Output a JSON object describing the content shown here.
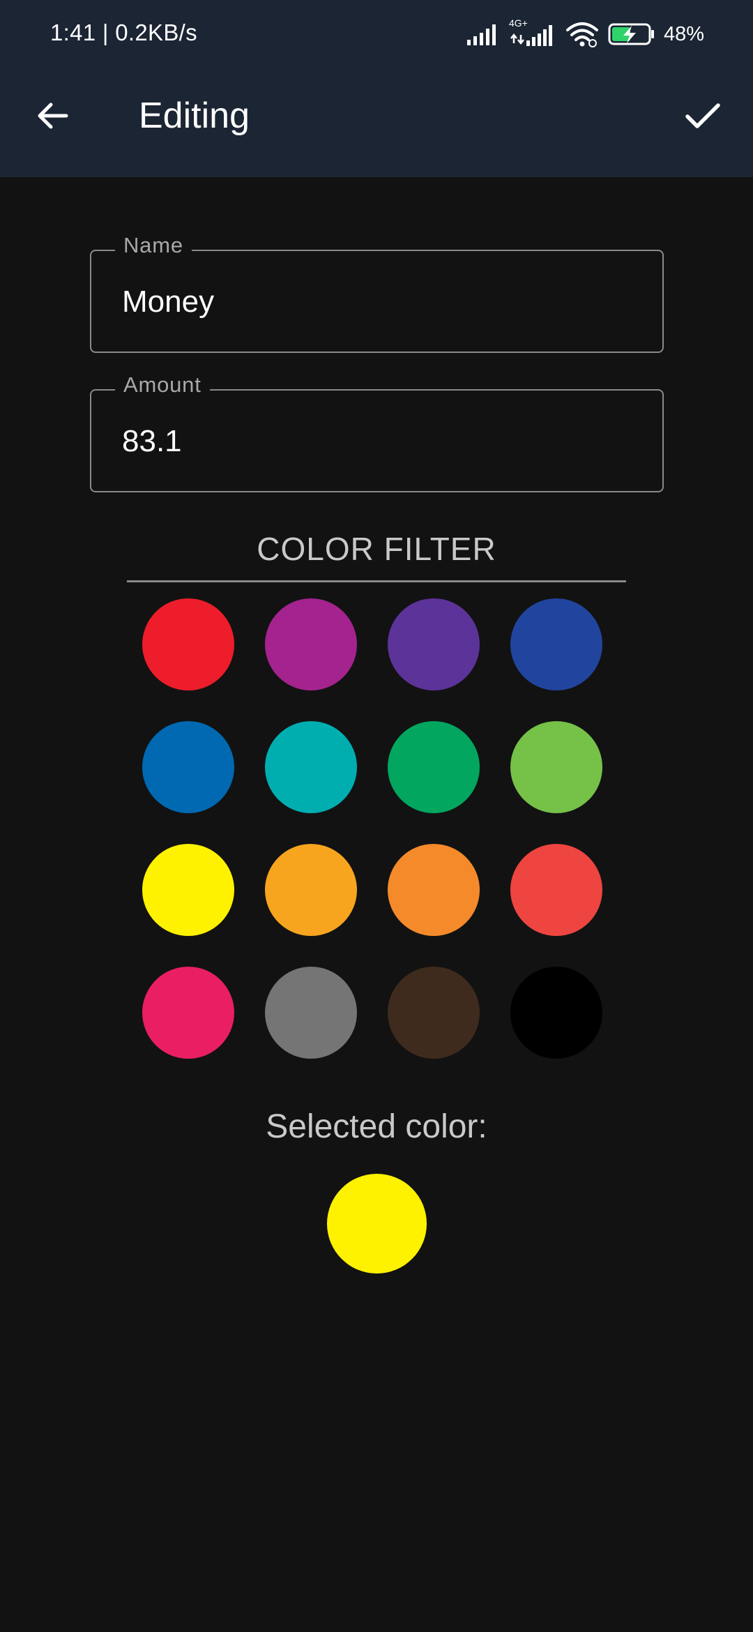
{
  "status_bar": {
    "time": "1:41 | 0.2KB/s",
    "network_type": "4G+",
    "battery": "48%",
    "icons": [
      "signal-icon",
      "signal-4g-icon",
      "wifi-icon",
      "battery-charging-icon"
    ]
  },
  "app_bar": {
    "title": "Editing",
    "back_icon": "arrow-back-icon",
    "confirm_icon": "check-icon",
    "background": "#1b2533"
  },
  "form": {
    "name_label": "Name",
    "name_value": "Money",
    "amount_label": "Amount",
    "amount_value": "83.1"
  },
  "color_filter": {
    "title": "COLOR FILTER",
    "colors": [
      "#ee1d2b",
      "#a4238f",
      "#5c3399",
      "#21459e",
      "#0069b2",
      "#00aeb0",
      "#02a65f",
      "#76c148",
      "#fef200",
      "#f7a51e",
      "#f58a2b",
      "#ee4540",
      "#e91e63",
      "#757575",
      "#3f2b1d",
      "#000000"
    ],
    "selected_label": "Selected color:",
    "selected_color": "#fef200"
  }
}
